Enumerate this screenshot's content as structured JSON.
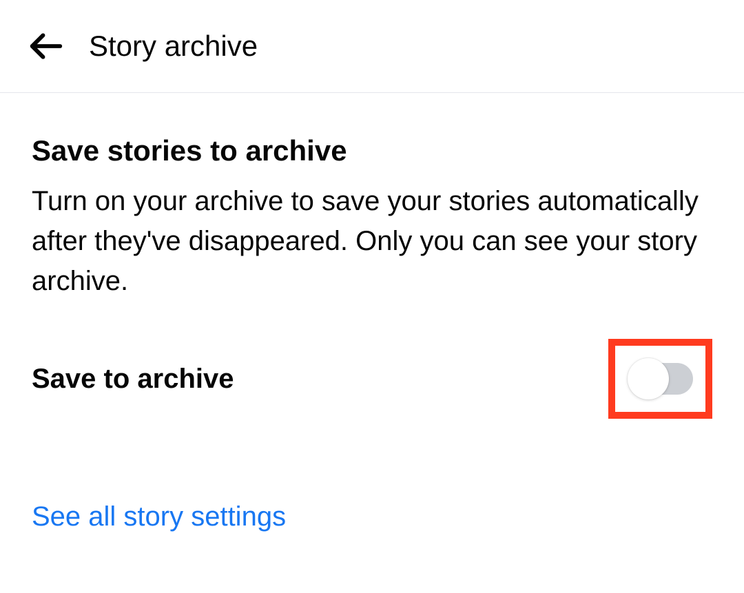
{
  "header": {
    "title": "Story archive"
  },
  "section": {
    "heading": "Save stories to archive",
    "description": "Turn on your archive to save your stories automatically after they've disappeared. Only you can see your story archive.",
    "toggle_label": "Save to archive",
    "toggle_state": "off"
  },
  "link": {
    "label": "See all story settings"
  },
  "colors": {
    "highlight": "#ff3b1f",
    "link": "#1877f2"
  }
}
